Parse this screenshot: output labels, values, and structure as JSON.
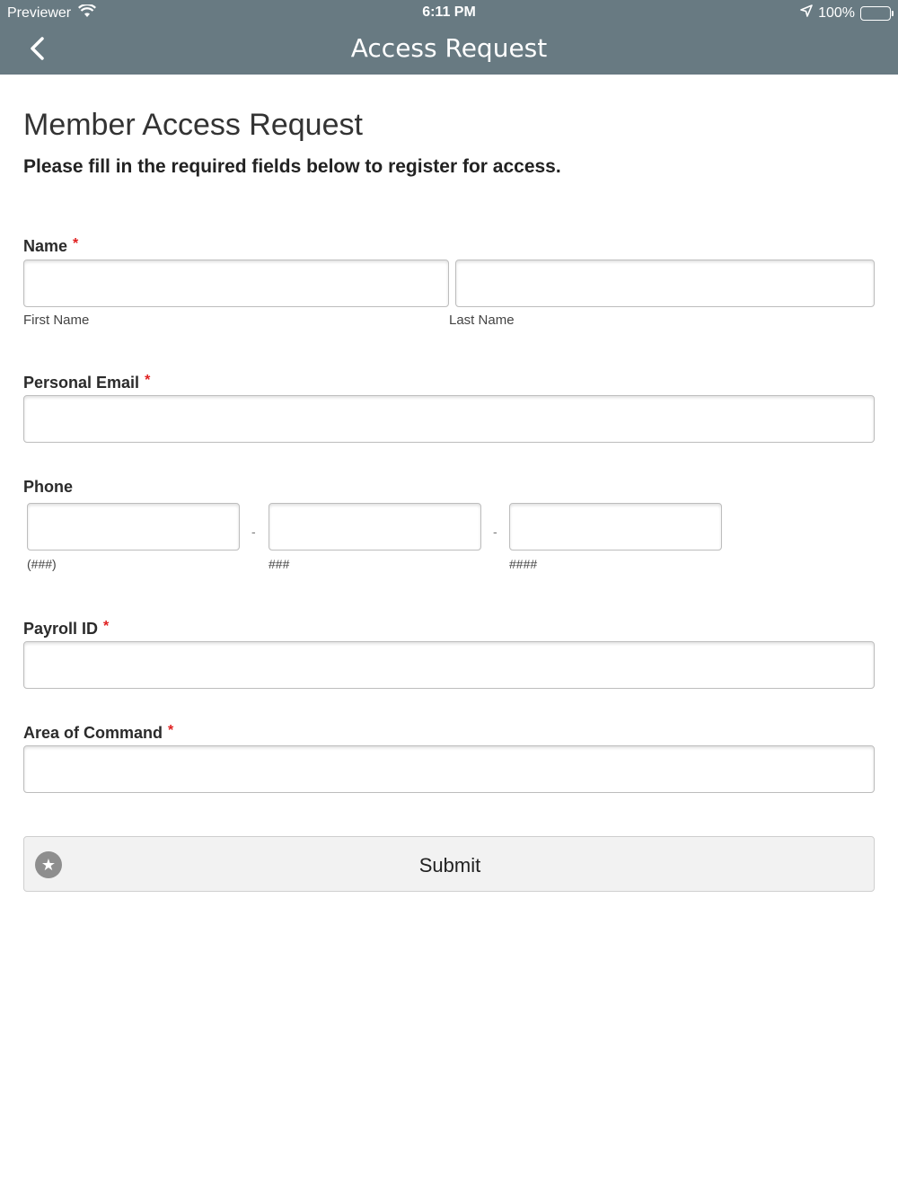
{
  "status_bar": {
    "carrier": "Previewer",
    "time": "6:11 PM",
    "battery": "100%",
    "icons": [
      "wifi-icon",
      "location-arrow-icon",
      "battery-icon"
    ]
  },
  "nav": {
    "title": "Access Request",
    "back_icon": "chevron-left-icon"
  },
  "page": {
    "title": "Member Access Request",
    "subtitle": "Please fill in the required fields below to register for access."
  },
  "form": {
    "required_marker": "*",
    "name": {
      "label": "Name",
      "first_sublabel": "First Name",
      "last_sublabel": "Last Name",
      "first_value": "",
      "last_value": ""
    },
    "email": {
      "label": "Personal Email",
      "value": ""
    },
    "phone": {
      "label": "Phone",
      "separator": "-",
      "area_hint": "(###)",
      "prefix_hint": "###",
      "line_hint": "####"
    },
    "payroll": {
      "label": "Payroll ID",
      "value": ""
    },
    "command": {
      "label": "Area of Command",
      "value": ""
    },
    "submit_label": "Submit",
    "submit_icon": "star-icon"
  },
  "colors": {
    "header_bg": "#687a82",
    "required": "#e02020",
    "button_bg": "#f2f2f2"
  }
}
